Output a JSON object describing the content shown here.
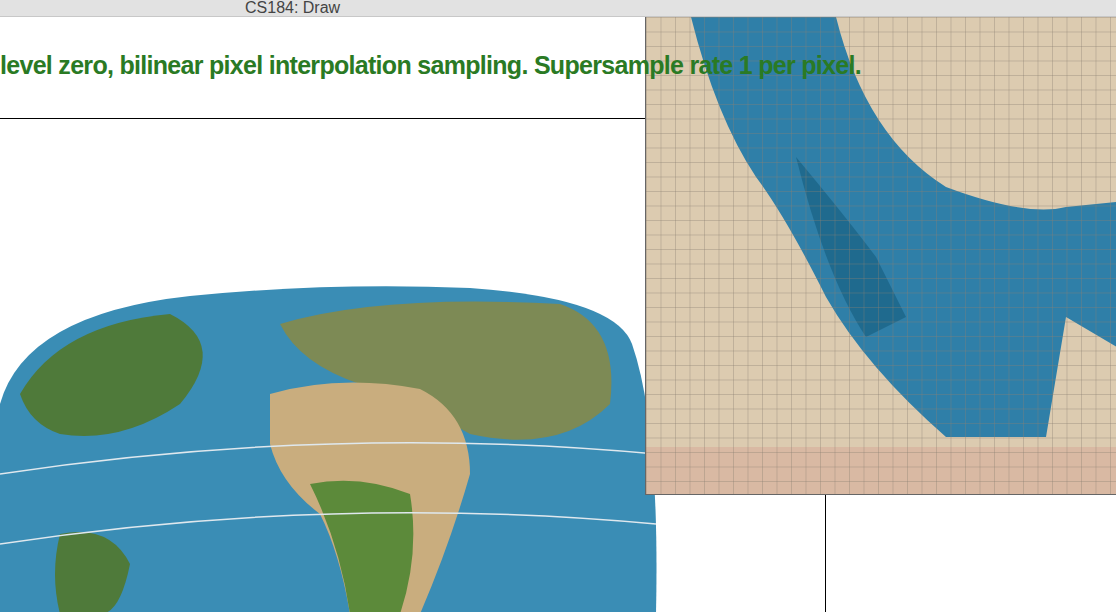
{
  "window": {
    "title": "CS184: Draw"
  },
  "status": {
    "text": "level zero, bilinear pixel interpolation sampling. Supersample rate 1 per pixel.",
    "color": "#2a7a24"
  }
}
